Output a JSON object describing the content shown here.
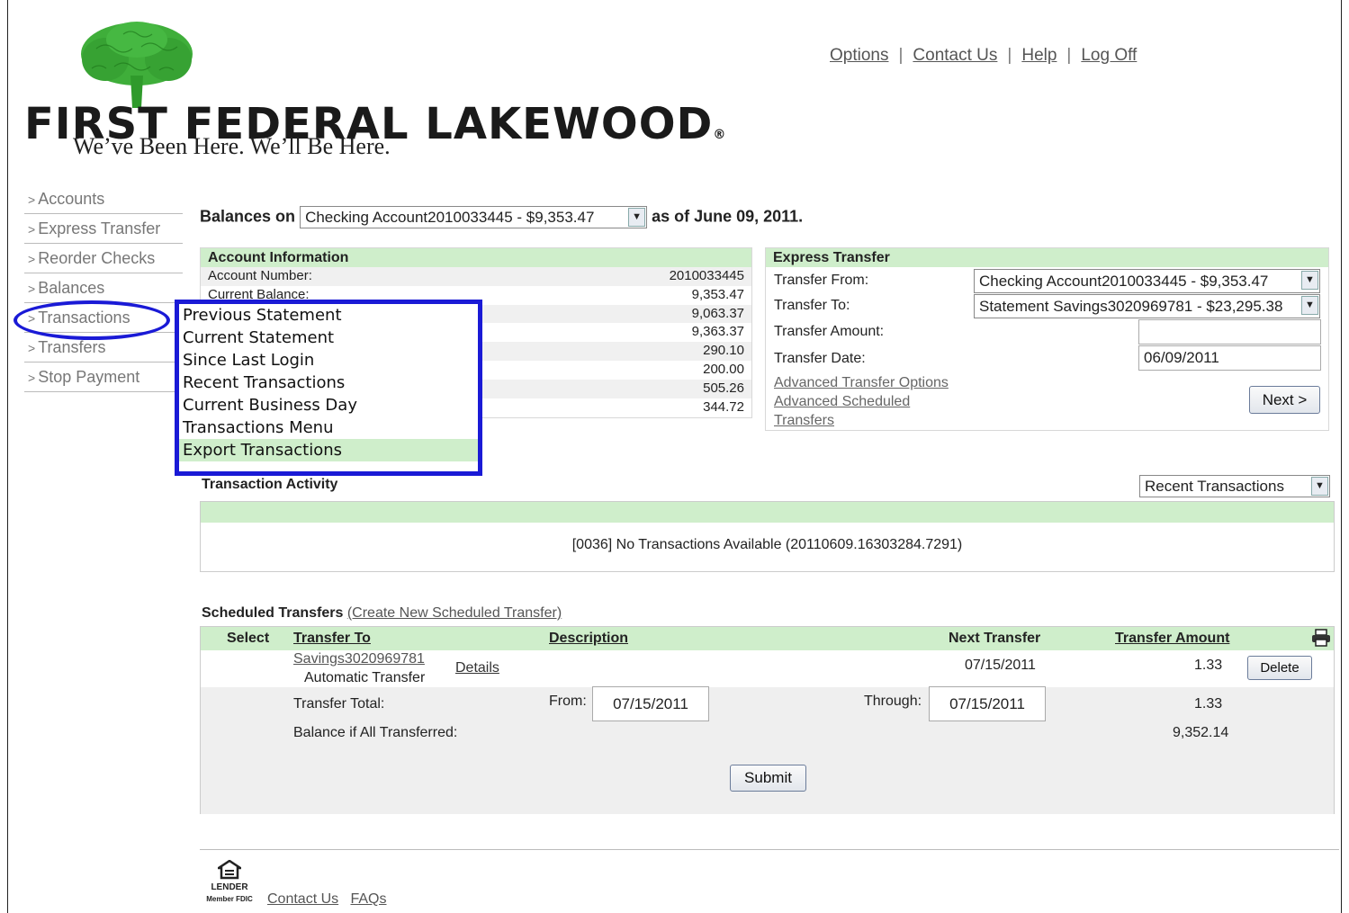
{
  "header": {
    "brand": "FIRST FEDERAL LAKEWOOD",
    "tagline": "We’ve Been Here.  We’ll Be Here.",
    "nav": [
      "Options",
      "Contact Us",
      "Help",
      "Log Off"
    ]
  },
  "sidebar": {
    "items": [
      "Accounts",
      "Express Transfer",
      "Reorder Checks",
      "Balances",
      "Transactions",
      "Transfers",
      "Stop Payment"
    ]
  },
  "transactions_menu": {
    "items": [
      "Previous Statement",
      "Current Statement",
      "Since Last Login",
      "Recent Transactions",
      "Current Business Day",
      "Transactions Menu",
      "Export Transactions"
    ],
    "highlighted": "Export Transactions"
  },
  "balances": {
    "label": "Balances on",
    "selected_account": "Checking Account2010033445 - $9,353.47",
    "as_of": "as of June 09, 2011."
  },
  "account_info": {
    "title": "Account Information",
    "rows": [
      {
        "label": "Account Number:",
        "value": "2010033445"
      },
      {
        "label": "Current Balance:",
        "value": "9,353.47"
      },
      {
        "label": "",
        "value": "9,063.37"
      },
      {
        "label": "",
        "value": "9,363.37"
      },
      {
        "label": "",
        "value": "290.10"
      },
      {
        "label": "",
        "value": "200.00"
      },
      {
        "label": "",
        "value": "505.26"
      },
      {
        "label": "",
        "value": "344.72"
      }
    ]
  },
  "express_transfer": {
    "title": "Express Transfer",
    "from_label": "Transfer From:",
    "from_value": "Checking Account2010033445 - $9,353.47",
    "to_label": "Transfer To:",
    "to_value": "Statement Savings3020969781 - $23,295.38",
    "amount_label": "Transfer Amount:",
    "amount_value": "",
    "date_label": "Transfer Date:",
    "date_value": "06/09/2011",
    "link_advanced_options": "Advanced Transfer Options",
    "link_advanced_scheduled": "Advanced Scheduled Transfers",
    "next_button": "Next >"
  },
  "transaction_activity": {
    "title": "Transaction Activity",
    "filter": "Recent Transactions",
    "message": "[0036] No Transactions Available (20110609.16303284.7291)"
  },
  "scheduled_transfers": {
    "title": "Scheduled Transfers",
    "create_link": "(Create New Scheduled Transfer)",
    "columns": {
      "select": "Select",
      "transfer_to": "Transfer To",
      "description": "Description",
      "next_transfer": "Next Transfer",
      "amount": "Transfer Amount"
    },
    "row": {
      "account_link": "Savings3020969781",
      "type": "Automatic Transfer",
      "details": "Details",
      "next_transfer": "07/15/2011",
      "amount": "1.33",
      "delete": "Delete"
    },
    "total_label": "Transfer Total:",
    "from_label": "From:",
    "from_date": "07/15/2011",
    "through_label": "Through:",
    "through_date": "07/15/2011",
    "total_value": "1.33",
    "balance_label": "Balance if All Transferred:",
    "balance_value": "9,352.14",
    "submit": "Submit"
  },
  "footer": {
    "lender_badge": "LENDER",
    "fdic": "Member FDIC",
    "links": [
      "Contact Us",
      "FAQs"
    ]
  },
  "colors": {
    "accent_green": "#cfeecb",
    "annotation_blue": "#1a1ad6",
    "logo_green": "#3fae3a"
  }
}
